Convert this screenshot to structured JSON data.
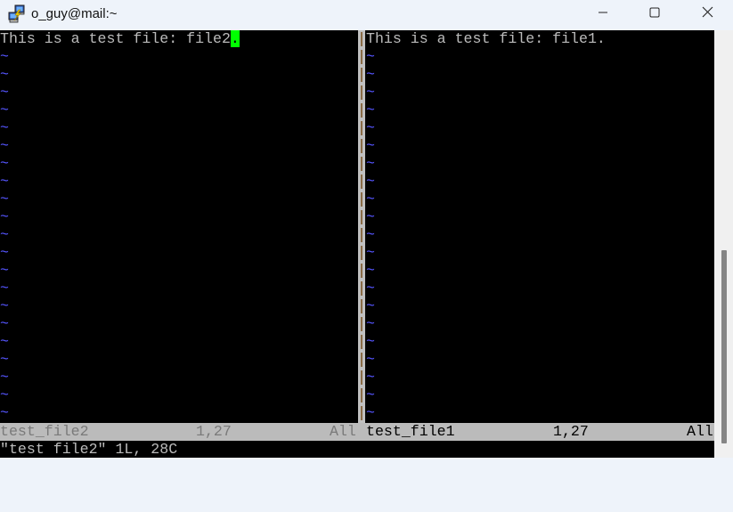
{
  "window": {
    "title": "o_guy@mail:~",
    "app_icon": "putty-icon",
    "controls": {
      "minimize": "minimize-icon",
      "maximize": "maximize-icon",
      "close": "close-icon"
    }
  },
  "editor": {
    "left_pane": {
      "first_line_text": "This is a test file: file2",
      "cursor_char": ".",
      "tilde_count": 21,
      "status": {
        "filename": "test_file2",
        "position": "1,27",
        "scroll": "All"
      }
    },
    "right_pane": {
      "first_line_text": "This is a test file: file1.",
      "tilde_count": 21,
      "status": {
        "filename": "test_file1",
        "position": "1,27",
        "scroll": "All"
      }
    },
    "tilde_char": "~",
    "divider_char": "|",
    "message_line": "\"test file2\" 1L, 28C"
  },
  "colors": {
    "terminal_bg": "#000000",
    "text": "#bbbbbb",
    "tilde": "#5555ff",
    "cursor": "#00ff00",
    "status_bg": "#bbbbbb",
    "status_inactive_text": "#7a7a7a",
    "status_active_text": "#000000"
  },
  "scrollbar": {
    "visible_fraction": 0.46,
    "position_fraction": 1.0
  }
}
